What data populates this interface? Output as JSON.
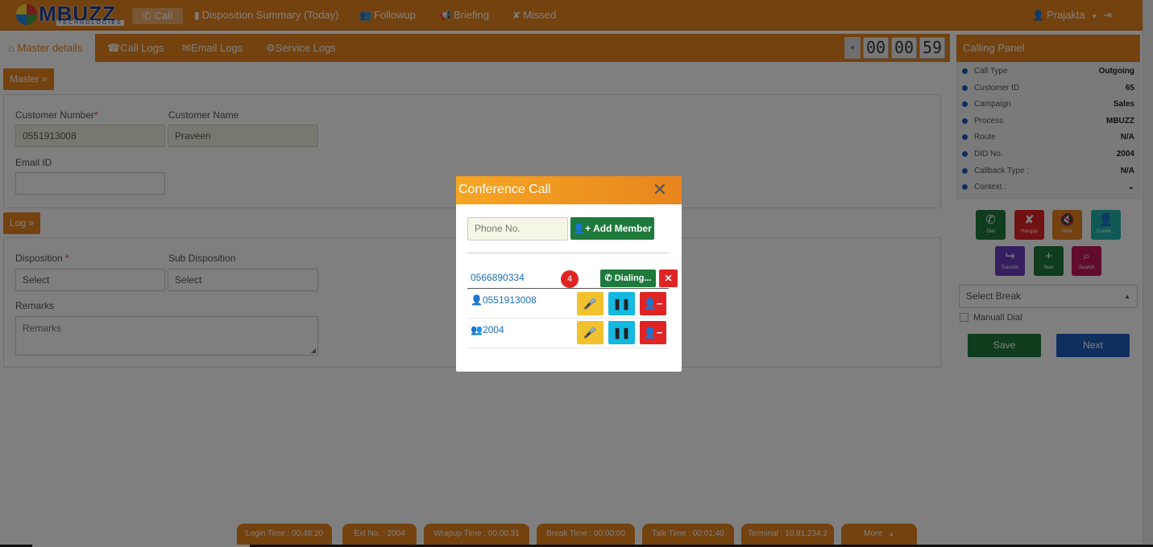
{
  "brand": {
    "name": "MBUZZ",
    "tagline": "TECHNOLOGIES"
  },
  "topnav": {
    "call": "Call",
    "disposition_summary": "Disposition Summary (Today)",
    "followup": "Followup",
    "briefing": "Briefing",
    "missed": "Missed",
    "user": "Prajakta"
  },
  "tabs": {
    "master_details": "Master details",
    "call_logs": "Call Logs",
    "email_logs": "Email Logs",
    "service_logs": "Service Logs"
  },
  "timer": {
    "hh": "00",
    "mm": "00",
    "ss": "59"
  },
  "master": {
    "tag": "Master",
    "customer_number_label": "Customer Number",
    "customer_number": "0551913008",
    "customer_name_label": "Customer Name",
    "customer_name": "Praveen",
    "email_label": "Email ID",
    "email": ""
  },
  "log": {
    "tag": "Log",
    "disposition_label": "Disposition",
    "disposition": "Select",
    "sub_disposition_label": "Sub Disposition",
    "sub_disposition": "Select",
    "remarks_label": "Remarks",
    "remarks_placeholder": "Remarks"
  },
  "conference": {
    "title": "Conference Call",
    "phone_placeholder": "Phone No.",
    "add_member": "Add Member",
    "dialing_number": "0566890334",
    "dialing_badge": "4",
    "dialing_label": "Dialing...",
    "members": [
      {
        "number": "0551913008"
      },
      {
        "number": "2004"
      }
    ]
  },
  "calling_panel": {
    "title": "Calling Panel",
    "rows": [
      {
        "label": "Call Type",
        "value": "Outgoing"
      },
      {
        "label": "Customer ID",
        "value": "65"
      },
      {
        "label": "Campaign",
        "value": "Sales"
      },
      {
        "label": "Process",
        "value": "MBUZZ"
      },
      {
        "label": "Route",
        "value": "N/A"
      },
      {
        "label": "DID No.",
        "value": "2004"
      },
      {
        "label": "Callback Type :",
        "value": "N/A"
      },
      {
        "label": "Context :",
        "value": ""
      }
    ],
    "actions": {
      "dial": "Dial",
      "hangup": "Hangup",
      "mute": "Mute",
      "conference": "Confer...",
      "transfer": "Transfer",
      "new": "New",
      "search": "Search"
    },
    "select_break": "Select Break",
    "manual_dial": "Manuall Dial",
    "save": "Save",
    "next": "Next"
  },
  "footer": {
    "login_time": "Login Time : 00:48:20",
    "ext_no": "Ext No. : 2004",
    "wrapup_time": "Wrapup Time : 00:00:31",
    "break_time": "Break Time : 00:00:00",
    "talk_time": "Talk Time : 00:01:40",
    "terminal": "Terminal : 10.81.234.2",
    "more": "More"
  },
  "colors": {
    "brand_orange": "#e8851e",
    "success_green": "#1e7a3c",
    "danger_red": "#e02424",
    "info_cyan": "#14b8e0",
    "warning_yellow": "#f2c12e",
    "primary_blue": "#1e5fbf"
  }
}
